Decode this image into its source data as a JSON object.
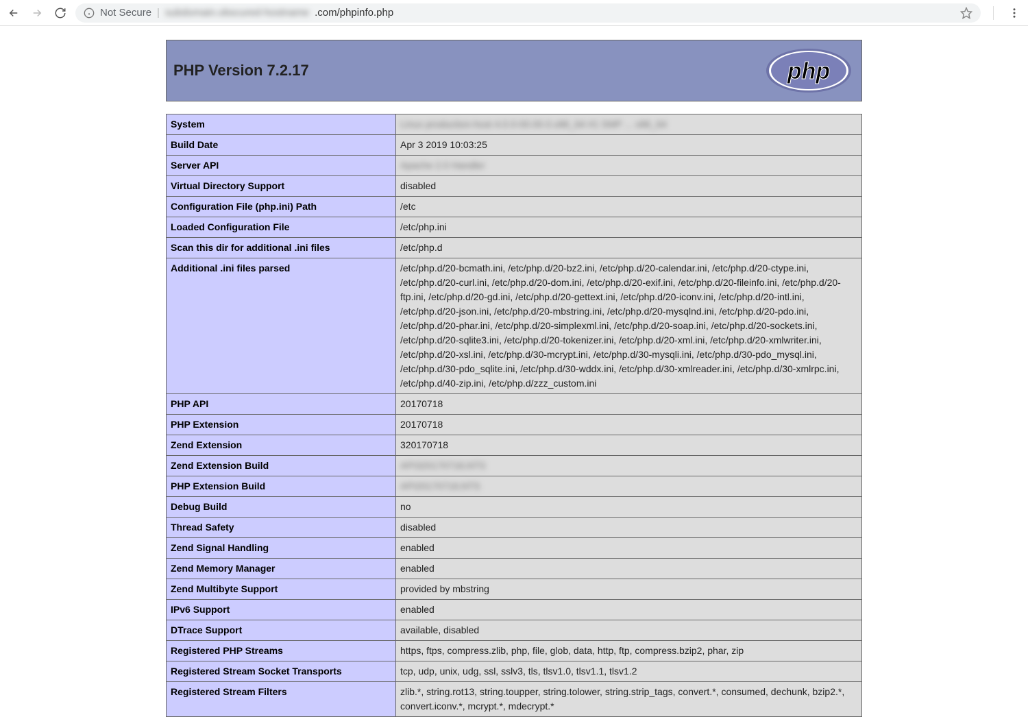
{
  "browser": {
    "not_secure_label": "Not Secure",
    "url_hidden": "subdomain.obscured-hostname",
    "url_visible": ".com/phpinfo.php"
  },
  "header": {
    "title": "PHP Version 7.2.17"
  },
  "info_rows": [
    {
      "key": "System",
      "val": "Linux production-host 4.0.0-00.00.0.x86_64 #1 SMP ... x86_64",
      "blurred": true
    },
    {
      "key": "Build Date",
      "val": "Apr 3 2019 10:03:25"
    },
    {
      "key": "Server API",
      "val": "Apache 2.0 Handler",
      "blurred": true
    },
    {
      "key": "Virtual Directory Support",
      "val": "disabled"
    },
    {
      "key": "Configuration File (php.ini) Path",
      "val": "/etc"
    },
    {
      "key": "Loaded Configuration File",
      "val": "/etc/php.ini"
    },
    {
      "key": "Scan this dir for additional .ini files",
      "val": "/etc/php.d"
    },
    {
      "key": "Additional .ini files parsed",
      "val": "/etc/php.d/20-bcmath.ini, /etc/php.d/20-bz2.ini, /etc/php.d/20-calendar.ini, /etc/php.d/20-ctype.ini, /etc/php.d/20-curl.ini, /etc/php.d/20-dom.ini, /etc/php.d/20-exif.ini, /etc/php.d/20-fileinfo.ini, /etc/php.d/20-ftp.ini, /etc/php.d/20-gd.ini, /etc/php.d/20-gettext.ini, /etc/php.d/20-iconv.ini, /etc/php.d/20-intl.ini, /etc/php.d/20-json.ini, /etc/php.d/20-mbstring.ini, /etc/php.d/20-mysqlnd.ini, /etc/php.d/20-pdo.ini, /etc/php.d/20-phar.ini, /etc/php.d/20-simplexml.ini, /etc/php.d/20-soap.ini, /etc/php.d/20-sockets.ini, /etc/php.d/20-sqlite3.ini, /etc/php.d/20-tokenizer.ini, /etc/php.d/20-xml.ini, /etc/php.d/20-xmlwriter.ini, /etc/php.d/20-xsl.ini, /etc/php.d/30-mcrypt.ini, /etc/php.d/30-mysqli.ini, /etc/php.d/30-pdo_mysql.ini, /etc/php.d/30-pdo_sqlite.ini, /etc/php.d/30-wddx.ini, /etc/php.d/30-xmlreader.ini, /etc/php.d/30-xmlrpc.ini, /etc/php.d/40-zip.ini, /etc/php.d/zzz_custom.ini"
    },
    {
      "key": "PHP API",
      "val": "20170718"
    },
    {
      "key": "PHP Extension",
      "val": "20170718"
    },
    {
      "key": "Zend Extension",
      "val": "320170718"
    },
    {
      "key": "Zend Extension Build",
      "val": "API320170718,NTS",
      "blurred": true
    },
    {
      "key": "PHP Extension Build",
      "val": "API20170718,NTS",
      "blurred": true
    },
    {
      "key": "Debug Build",
      "val": "no"
    },
    {
      "key": "Thread Safety",
      "val": "disabled"
    },
    {
      "key": "Zend Signal Handling",
      "val": "enabled"
    },
    {
      "key": "Zend Memory Manager",
      "val": "enabled"
    },
    {
      "key": "Zend Multibyte Support",
      "val": "provided by mbstring"
    },
    {
      "key": "IPv6 Support",
      "val": "enabled"
    },
    {
      "key": "DTrace Support",
      "val": "available, disabled"
    },
    {
      "key": "Registered PHP Streams",
      "val": "https, ftps, compress.zlib, php, file, glob, data, http, ftp, compress.bzip2, phar, zip"
    },
    {
      "key": "Registered Stream Socket Transports",
      "val": "tcp, udp, unix, udg, ssl, sslv3, tls, tlsv1.0, tlsv1.1, tlsv1.2"
    },
    {
      "key": "Registered Stream Filters",
      "val": "zlib.*, string.rot13, string.toupper, string.tolower, string.strip_tags, convert.*, consumed, dechunk, bzip2.*, convert.iconv.*, mcrypt.*, mdecrypt.*"
    }
  ]
}
